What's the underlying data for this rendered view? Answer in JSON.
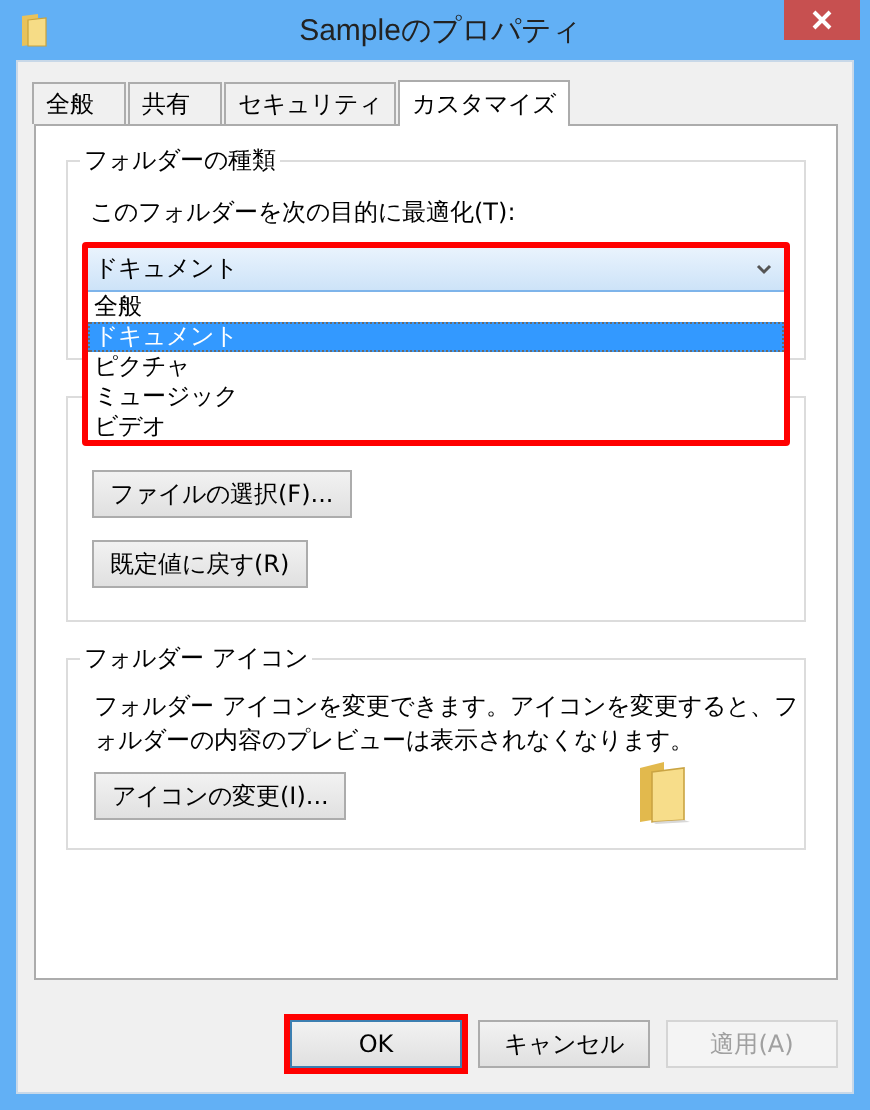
{
  "window": {
    "title": "Sampleのプロパティ"
  },
  "tabs": [
    {
      "label": "全般",
      "selected": false
    },
    {
      "label": "共有",
      "selected": false
    },
    {
      "label": "セキュリティ",
      "selected": false
    },
    {
      "label": "カスタマイズ",
      "selected": true
    }
  ],
  "folder_type": {
    "title": "フォルダーの種類",
    "label": "このフォルダーを次の目的に最適化(T):",
    "dropdown": {
      "value": "ドキュメント",
      "highlighted": true,
      "options": [
        {
          "label": "全般",
          "selected": false
        },
        {
          "label": "ドキュメント",
          "selected": true
        },
        {
          "label": "ピクチャ",
          "selected": false
        },
        {
          "label": "ミュージック",
          "selected": false
        },
        {
          "label": "ビデオ",
          "selected": false
        }
      ]
    }
  },
  "folder_picture": {
    "buttons": [
      {
        "label": "ファイルの選択(F)..."
      },
      {
        "label": "既定値に戻す(R)"
      }
    ]
  },
  "folder_icon": {
    "title": "フォルダー アイコン",
    "description": "フォルダー アイコンを変更できます。アイコンを変更すると、フォルダーの内容のプレビューは表示されなくなります。",
    "button": "アイコンの変更(I)..."
  },
  "buttons": [
    {
      "label": "OK",
      "disabled": false,
      "highlighted": true
    },
    {
      "label": "キャンセル",
      "disabled": false,
      "highlighted": false
    },
    {
      "label": "適用(A)",
      "disabled": true,
      "highlighted": false
    }
  ]
}
